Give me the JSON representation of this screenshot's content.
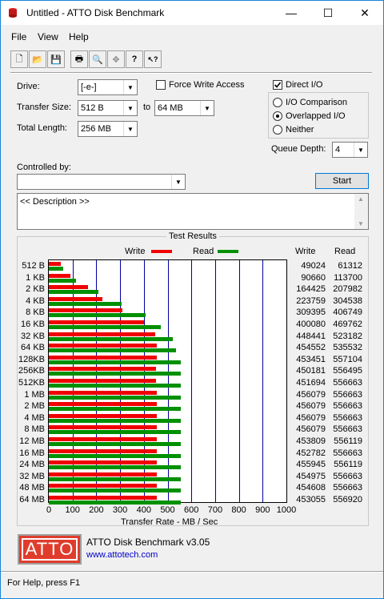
{
  "window": {
    "title": "Untitled - ATTO Disk Benchmark",
    "minimize": "—",
    "maximize": "☐",
    "close": "✕"
  },
  "menu": {
    "items": [
      "File",
      "View",
      "Help"
    ]
  },
  "toolbar": {
    "buttons": [
      {
        "name": "new-icon",
        "glyph": "🗋"
      },
      {
        "name": "open-icon",
        "glyph": "📂"
      },
      {
        "name": "save-icon",
        "glyph": "💾"
      },
      {
        "name": "print-icon",
        "glyph": "🖶"
      },
      {
        "name": "print-preview-icon",
        "glyph": "🔍"
      },
      {
        "name": "move-icon",
        "glyph": "✥"
      },
      {
        "name": "help-icon",
        "glyph": "?"
      },
      {
        "name": "context-help-icon",
        "glyph": "↖?"
      }
    ]
  },
  "settings": {
    "drive_label": "Drive:",
    "drive_value": "[-e-]",
    "force_write_label": "Force Write Access",
    "direct_io_label": "Direct I/O",
    "transfer_size_label": "Transfer Size:",
    "transfer_from": "512 B",
    "to_label": "to",
    "transfer_to": "64 MB",
    "total_length_label": "Total Length:",
    "total_length_value": "256 MB",
    "io_comparison_label": "I/O Comparison",
    "overlapped_label": "Overlapped I/O",
    "neither_label": "Neither",
    "queue_depth_label": "Queue Depth:",
    "queue_depth_value": "4",
    "controlled_by_label": "Controlled by:",
    "controlled_by_value": "",
    "start_button": "Start",
    "description": "<< Description >>"
  },
  "results": {
    "group_title": "Test Results",
    "legend_write": "Write",
    "legend_read": "Read",
    "col_write": "Write",
    "col_read": "Read",
    "xlabel": "Transfer Rate - MB / Sec"
  },
  "colors": {
    "write": "#f00000",
    "read": "#009000",
    "grid": "#0000a0"
  },
  "chart_data": {
    "type": "bar",
    "orientation": "horizontal",
    "xlabel": "Transfer Rate - MB / Sec",
    "xlim": [
      0,
      1000
    ],
    "xticks": [
      0,
      100,
      200,
      300,
      400,
      500,
      600,
      700,
      800,
      900,
      1000
    ],
    "categories": [
      "512 B",
      "1 KB",
      "2 KB",
      "4 KB",
      "8 KB",
      "16 KB",
      "32 KB",
      "64 KB",
      "128KB",
      "256KB",
      "512KB",
      "1 MB",
      "2 MB",
      "4 MB",
      "8 MB",
      "12 MB",
      "16 MB",
      "24 MB",
      "32 MB",
      "48 MB",
      "64 MB"
    ],
    "series": [
      {
        "name": "Write",
        "values_mb": [
          49,
          91,
          164,
          224,
          309,
          400,
          448,
          455,
          453,
          450,
          452,
          456,
          456,
          456,
          456,
          454,
          453,
          456,
          455,
          455,
          453
        ],
        "values_text": [
          "49024",
          "90660",
          "164425",
          "223759",
          "309395",
          "400080",
          "448441",
          "454552",
          "453451",
          "450181",
          "451694",
          "456079",
          "456079",
          "456079",
          "456079",
          "453809",
          "452782",
          "455945",
          "454975",
          "454608",
          "453055"
        ]
      },
      {
        "name": "Read",
        "values_mb": [
          61,
          114,
          208,
          305,
          407,
          470,
          523,
          536,
          557,
          556,
          557,
          557,
          557,
          557,
          557,
          556,
          557,
          556,
          557,
          557,
          557
        ],
        "values_text": [
          "61312",
          "113700",
          "207982",
          "304538",
          "406749",
          "469762",
          "523182",
          "535532",
          "557104",
          "556495",
          "556663",
          "556663",
          "556663",
          "556663",
          "556663",
          "556119",
          "556663",
          "556119",
          "556663",
          "556663",
          "556920"
        ]
      }
    ]
  },
  "footer": {
    "logo_text": "ATTO",
    "app_version": "ATTO Disk Benchmark v3.05",
    "website": "www.attotech.com"
  },
  "status": {
    "text": "For Help, press F1"
  }
}
